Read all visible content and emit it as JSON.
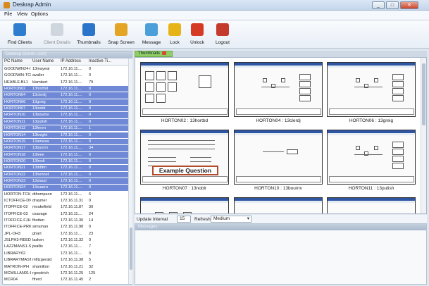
{
  "window": {
    "title": "Deskrap Admin"
  },
  "menu": [
    "File",
    "View",
    "Options"
  ],
  "toolbar": [
    {
      "label": "Find Clients",
      "icon": "find-clients-icon",
      "enabled": true,
      "color": "#2f7dcf"
    },
    {
      "label": "Client Details",
      "icon": "client-details-icon",
      "enabled": false,
      "color": "#cfd6de"
    },
    {
      "label": "Thumbnails",
      "icon": "thumbnails-icon",
      "enabled": true,
      "color": "#2a74c9"
    },
    {
      "label": "Snap Screen",
      "icon": "snap-screen-icon",
      "enabled": true,
      "color": "#e4a524"
    },
    {
      "label": "Message",
      "icon": "message-icon",
      "enabled": true,
      "color": "#4c9fd8"
    },
    {
      "label": "Lock",
      "icon": "lock-icon",
      "enabled": true,
      "color": "#e7b418"
    },
    {
      "label": "Unlock",
      "icon": "unlock-icon",
      "enabled": true,
      "color": "#d53a25"
    },
    {
      "label": "Logout",
      "icon": "logout-icon",
      "enabled": true,
      "color": "#c43a2b"
    }
  ],
  "left_panel": {
    "title": "Desktop Clients (130)",
    "columns": [
      "PC Name",
      "User Name",
      "IP Address",
      "Inactive Ti..."
    ],
    "rows": [
      {
        "pc": "GOODWIN24-IT1",
        "user": "13mayeal",
        "ip": "172.16.11....",
        "inactive": "0",
        "sel": false
      },
      {
        "pc": "GOODWIN-TCH",
        "user": "avaller",
        "ip": "172.16.11....",
        "inactive": "0",
        "sel": false
      },
      {
        "pc": "HEABLE-BL1",
        "user": "klambert",
        "ip": "172.16.11....",
        "inactive": "79",
        "sel": false
      },
      {
        "pc": "HORTON02",
        "user": "13hortbd",
        "ip": "172.16.11....",
        "inactive": "0",
        "sel": true
      },
      {
        "pc": "HORTON04",
        "user": "13clerdj",
        "ip": "172.16.11....",
        "inactive": "0",
        "sel": true
      },
      {
        "pc": "HORTON06",
        "user": "13greig",
        "ip": "172.16.11....",
        "inactive": "0",
        "sel": true
      },
      {
        "pc": "HORTON07",
        "user": "13noblr",
        "ip": "172.16.11....",
        "inactive": "0",
        "sel": true
      },
      {
        "pc": "HORTON10",
        "user": "13bournv",
        "ip": "172.16.11....",
        "inactive": "0",
        "sel": true
      },
      {
        "pc": "HORTON11",
        "user": "13putish",
        "ip": "172.16.11....",
        "inactive": "0",
        "sel": true
      },
      {
        "pc": "HORTON12",
        "user": "13freen",
        "ip": "172.16.11....",
        "inactive": "1",
        "sel": true
      },
      {
        "pc": "HORTON14",
        "user": "13knight",
        "ip": "172.16.11....",
        "inactive": "0",
        "sel": true
      },
      {
        "pc": "HORTON15",
        "user": "13ameaa",
        "ip": "172.16.11....",
        "inactive": "0",
        "sel": true
      },
      {
        "pc": "HORTON17",
        "user": "13burnm",
        "ip": "172.16.11....",
        "inactive": "34",
        "sel": true
      },
      {
        "pc": "HORTON18",
        "user": "13leee",
        "ip": "172.16.11....",
        "inactive": "0",
        "sel": true
      },
      {
        "pc": "HORTON20",
        "user": "13fredt",
        "ip": "172.16.11....",
        "inactive": "0",
        "sel": true
      },
      {
        "pc": "HORTON21",
        "user": "13dditm",
        "ip": "172.16.11....",
        "inactive": "0",
        "sel": true
      },
      {
        "pc": "HORTON22",
        "user": "13hennet",
        "ip": "172.16.11....",
        "inactive": "0",
        "sel": true
      },
      {
        "pc": "HORTON23",
        "user": "13staud",
        "ip": "172.16.11....",
        "inactive": "0",
        "sel": true
      },
      {
        "pc": "HORTON24",
        "user": "13suarro",
        "ip": "172.16.11....",
        "inactive": "0",
        "sel": true
      },
      {
        "pc": "HORTON-TCH",
        "user": "dthompson",
        "ip": "172.16.11....",
        "inactive": "6",
        "sel": false
      },
      {
        "pc": "ICTOFFICE-DNR",
        "user": "draymer",
        "ip": "172.16.11.31",
        "inactive": "0",
        "sel": false
      },
      {
        "pc": "ITOFFICE-02",
        "user": "mvakefield",
        "ip": "172.16.11.87",
        "inactive": "30",
        "sel": false
      },
      {
        "pc": "ITOFFICE-03",
        "user": "csavage",
        "ip": "172.16.11....",
        "inactive": "24",
        "sel": false
      },
      {
        "pc": "ITOFFICE-FJH",
        "user": "fbotten",
        "ip": "172.16.11.30",
        "inactive": "14",
        "sel": false
      },
      {
        "pc": "ITOFFICE-PRK",
        "user": "simsman",
        "ip": "172.16.11.98",
        "inactive": "0",
        "sel": false
      },
      {
        "pc": "JPL-OH3",
        "user": "ghart",
        "ip": "172.16.11....",
        "inactive": "23",
        "sel": false
      },
      {
        "pc": "JSLPH3-REEDS",
        "user": "lasken",
        "ip": "172.16.11.32",
        "inactive": "0",
        "sel": false
      },
      {
        "pc": "LAZZMANS1-SC1",
        "user": "jwallis",
        "ip": "172.16.11....",
        "inactive": "7",
        "sel": false
      },
      {
        "pc": "LIBRARY02",
        "user": "",
        "ip": "172.16.11....",
        "inactive": "0",
        "sel": false
      },
      {
        "pc": "LIBRARYMASTER",
        "user": "mfitzgerald",
        "ip": "172.16.11.38",
        "inactive": "5",
        "sel": false
      },
      {
        "pc": "MATRON-IPH",
        "user": "shamilton",
        "ip": "172.16.11.21",
        "inactive": "32",
        "sel": false
      },
      {
        "pc": "MCMILLAN01-PSY1",
        "user": "rgoodrich",
        "ip": "172.16.11.25",
        "inactive": "125",
        "sel": false
      },
      {
        "pc": "MCR04",
        "user": "ffrerd",
        "ip": "172.16.11.45",
        "inactive": "2",
        "sel": false
      }
    ]
  },
  "thumbnails": {
    "tab": "Thumbnails",
    "cards": [
      {
        "caption": "HORTON02 : 13hortbd",
        "style": "dice"
      },
      {
        "caption": "HORTON04 : 13clerdj",
        "style": "cubes"
      },
      {
        "caption": "HORTON06 : 13greig",
        "style": "cubes"
      },
      {
        "caption": "HORTON07 : 13noblr",
        "style": "example",
        "banner": "Example Question"
      },
      {
        "caption": "HORTON10 : 13bournv",
        "style": "question"
      },
      {
        "caption": "HORTON11 : 13putish",
        "style": "cubes"
      },
      {
        "caption": "",
        "style": "grid"
      },
      {
        "caption": "",
        "style": "text"
      },
      {
        "caption": "",
        "style": "text"
      }
    ]
  },
  "update": {
    "label": "Update Interval",
    "value": "15",
    "refresh": "Refresh",
    "quality": "Medium"
  },
  "messages": {
    "title": "Messages"
  }
}
